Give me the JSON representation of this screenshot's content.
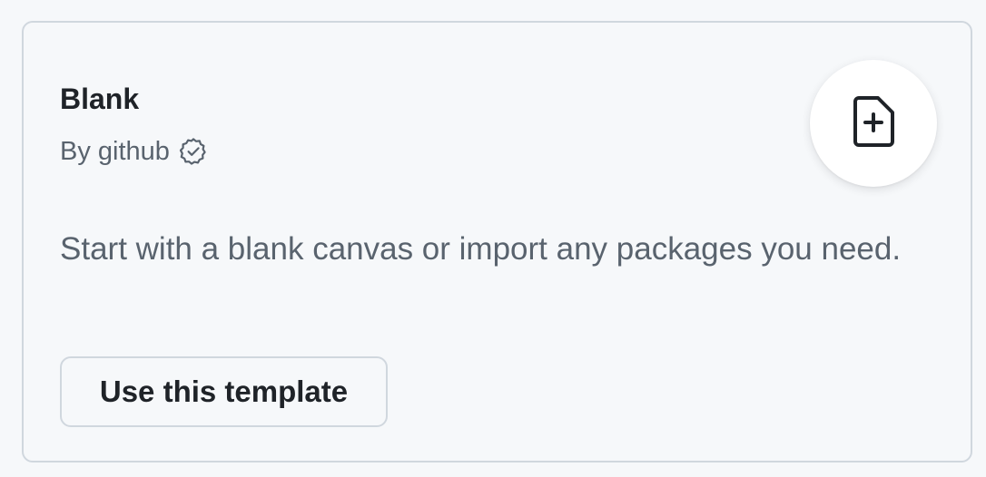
{
  "template": {
    "title": "Blank",
    "author": "By github",
    "description": "Start with a blank canvas or import any packages you need.",
    "button_label": "Use this template",
    "icon": "file-add-icon",
    "verified_icon": "verified-badge-icon"
  },
  "colors": {
    "background": "#f6f8fa",
    "border": "#d0d7de",
    "text_primary": "#1f2328",
    "text_muted": "#59636e",
    "icon_bg": "#ffffff"
  }
}
